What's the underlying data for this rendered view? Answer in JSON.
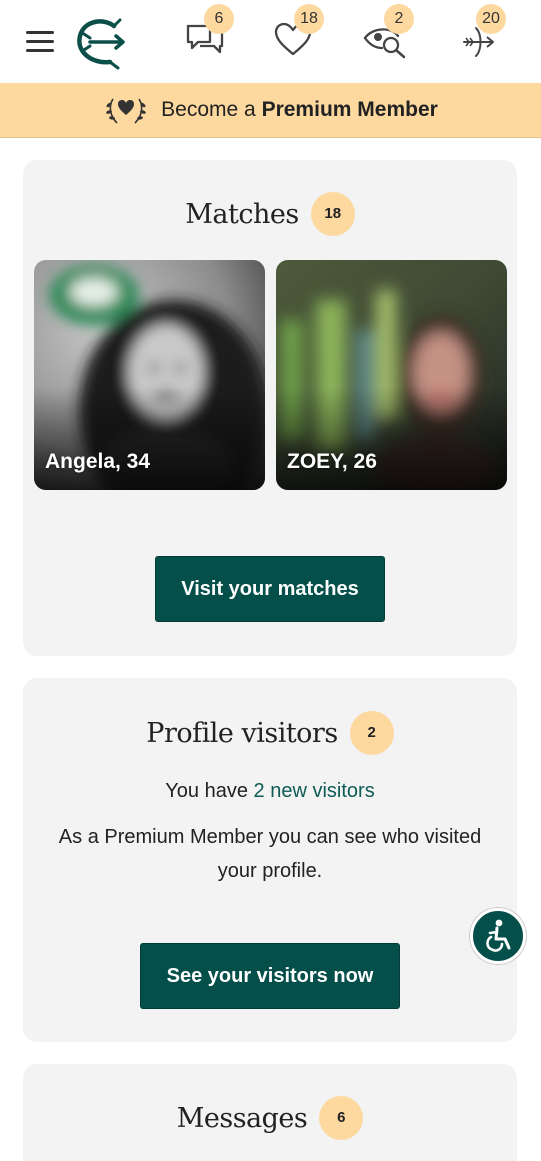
{
  "nav": {
    "messages_count": "6",
    "likes_count": "18",
    "visitors_count": "2",
    "matches_count": "20"
  },
  "premium": {
    "prefix": "Become a",
    "emphasis": "Premium Member"
  },
  "matches": {
    "title": "Matches",
    "count": "18",
    "people": [
      {
        "name": "Angela, 34"
      },
      {
        "name": "ZOEY, 26"
      }
    ],
    "cta": "Visit your matches"
  },
  "visitors": {
    "title": "Profile visitors",
    "count": "2",
    "line_prefix": "You have",
    "line_link": "2 new visitors",
    "description": "As a Premium Member you can see who visited your profile.",
    "cta": "See your visitors now"
  },
  "messages": {
    "title": "Messages",
    "count": "6"
  },
  "colors": {
    "accent": "#044f4a",
    "badge": "#fdd9a0",
    "card": "#f3f3f3"
  },
  "icons": [
    "menu-icon",
    "logo-icon",
    "chat-icon",
    "heart-icon",
    "eye-search-icon",
    "arrow-icon",
    "laurel-heart-icon",
    "accessibility-icon"
  ]
}
